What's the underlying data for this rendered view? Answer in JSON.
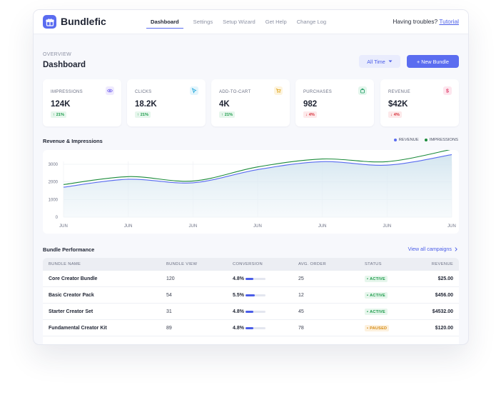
{
  "app": {
    "name": "Bundlefic",
    "brand_color": "#5a6cf0",
    "logo_icon": "gift-icon"
  },
  "nav": {
    "items": [
      {
        "label": "Dashboard",
        "active": true
      },
      {
        "label": "Settings",
        "active": false
      },
      {
        "label": "Setup Wizard",
        "active": false
      },
      {
        "label": "Get Help",
        "active": false
      },
      {
        "label": "Change Log",
        "active": false
      }
    ]
  },
  "help": {
    "prefix": "Having troubles?",
    "link": "Tutorial"
  },
  "header": {
    "eyebrow": "OVERVIEW",
    "title": "Dashboard",
    "range_label": "All Time",
    "new_bundle_label": "+ New Bundle"
  },
  "stats": [
    {
      "label": "IMPRESSIONS",
      "value": "124K",
      "delta": "21%",
      "direction": "up",
      "icon": "eye-icon",
      "icon_color": "#7b6cf0",
      "icon_bg": "#efeafe"
    },
    {
      "label": "CLICKS",
      "value": "18.2K",
      "delta": "21%",
      "direction": "up",
      "icon": "cursor-icon",
      "icon_color": "#1aa3d9",
      "icon_bg": "#e3f5fc"
    },
    {
      "label": "ADD-TO-CART",
      "value": "4K",
      "delta": "21%",
      "direction": "up",
      "icon": "cart-icon",
      "icon_color": "#e0a216",
      "icon_bg": "#fdf4de"
    },
    {
      "label": "PURCHASES",
      "value": "982",
      "delta": "4%",
      "direction": "down",
      "icon": "bag-icon",
      "icon_color": "#1a9a60",
      "icon_bg": "#e3f6ec"
    },
    {
      "label": "REVENUE",
      "value": "$42K",
      "delta": "4%",
      "direction": "down",
      "icon": "dollar-icon",
      "icon_color": "#e0406c",
      "icon_bg": "#fde6ee"
    }
  ],
  "chart_section": {
    "title": "Revenue & Impressions"
  },
  "chart_data": {
    "type": "line",
    "title": "Revenue & Impressions",
    "categories": [
      "JUN",
      "JUN",
      "JUN",
      "JUN",
      "JUN",
      "JUN",
      "JUN"
    ],
    "yticks": [
      0,
      1000,
      2000,
      3000
    ],
    "ylim": [
      0,
      3000
    ],
    "grid": true,
    "legend_position": "top-right",
    "series": [
      {
        "name": "REVENUE",
        "color": "#5a6cf0",
        "values": [
          1700,
          2150,
          1950,
          2700,
          3150,
          2950,
          3550
        ]
      },
      {
        "name": "IMPRESSIONS",
        "color": "#1a8a3a",
        "values": [
          1850,
          2300,
          2050,
          2850,
          3300,
          3150,
          3850
        ]
      }
    ]
  },
  "table": {
    "section_title": "Bundle Performance",
    "view_all": "View all campaigns",
    "columns": [
      "BUNDLE NAME",
      "BUNDLE VIEW",
      "CONVERSION",
      "AVG. ORDER",
      "STATUS",
      "REVENUE"
    ],
    "rows": [
      {
        "name": "Core Creator Bundle",
        "views": "120",
        "conversion": "4.8%",
        "conversion_pct": 40,
        "avg_order": "25",
        "status": "ACTIVE",
        "status_kind": "active",
        "revenue": "$25.00"
      },
      {
        "name": "Basic Creator Pack",
        "views": "54",
        "conversion": "5.5%",
        "conversion_pct": 46,
        "avg_order": "12",
        "status": "ACTIVE",
        "status_kind": "active",
        "revenue": "$456.00"
      },
      {
        "name": "Starter Creator Set",
        "views": "31",
        "conversion": "4.8%",
        "conversion_pct": 40,
        "avg_order": "45",
        "status": "ACTIVE",
        "status_kind": "active",
        "revenue": "$4532.00"
      },
      {
        "name": "Fundamental Creator Kit",
        "views": "89",
        "conversion": "4.8%",
        "conversion_pct": 40,
        "avg_order": "78",
        "status": "PAUSED",
        "status_kind": "paused",
        "revenue": "$120.00"
      }
    ]
  }
}
